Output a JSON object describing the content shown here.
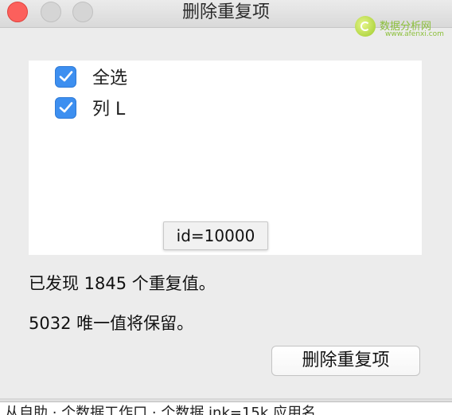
{
  "window": {
    "title": "删除重复项"
  },
  "watermark": {
    "text": "数据分析网",
    "sub": "www.afenxi.com"
  },
  "columns": {
    "items": [
      {
        "label": "全选",
        "checked": true
      },
      {
        "label": "列 L",
        "checked": true
      }
    ]
  },
  "tooltip": {
    "text": "id=10000"
  },
  "summary": {
    "duplicates": "已发现 1845 个重复值。",
    "unique": "5032 唯一值将保留。"
  },
  "actions": {
    "remove_label": "删除重复项"
  },
  "background": {
    "partial_text": "从自助  · 个数据工作口 · 个数据    ink=15k    应用名"
  },
  "colors": {
    "checkbox": "#3d8ff0",
    "close": "#fc605c",
    "watermark": "#8bbf3a"
  }
}
